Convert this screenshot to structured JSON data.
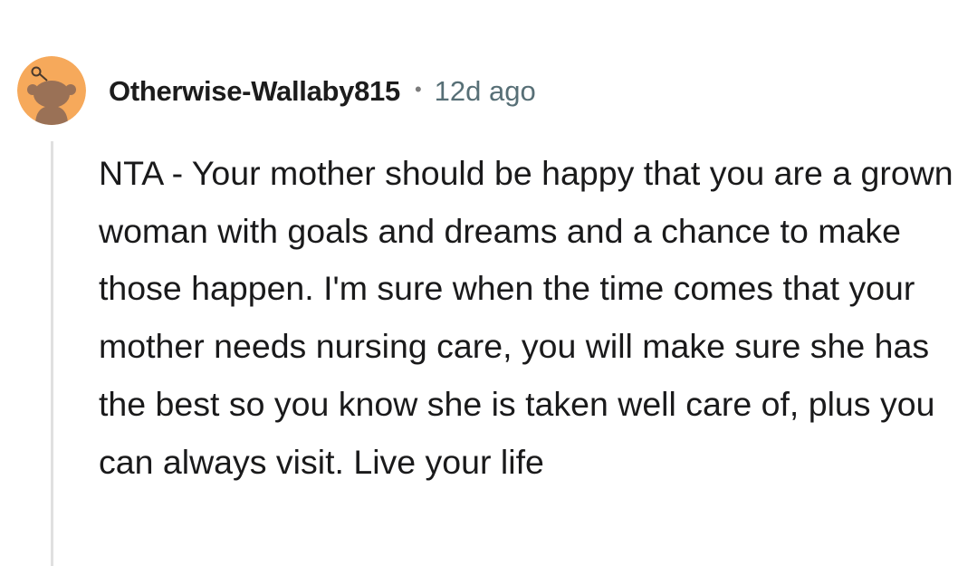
{
  "comment": {
    "author": "Otherwise-Wallaby815",
    "separator": "•",
    "timestamp": "12d ago",
    "avatar_icon": "snoo-avatar-icon",
    "avatar_color": "#F6A95B",
    "body": "NTA - Your mother should be happy that you are a grown woman with goals and dreams and a chance to make those happen. I'm sure when the time comes that your mother needs nursing care, you will make sure she has the best so you know she is taken well care of, plus you can always visit. Live your life"
  },
  "colors": {
    "author": "#1C1C1C",
    "timestamp": "#576F76",
    "thread_line": "#E0E0E0",
    "body_text": "#1A1A1B"
  }
}
